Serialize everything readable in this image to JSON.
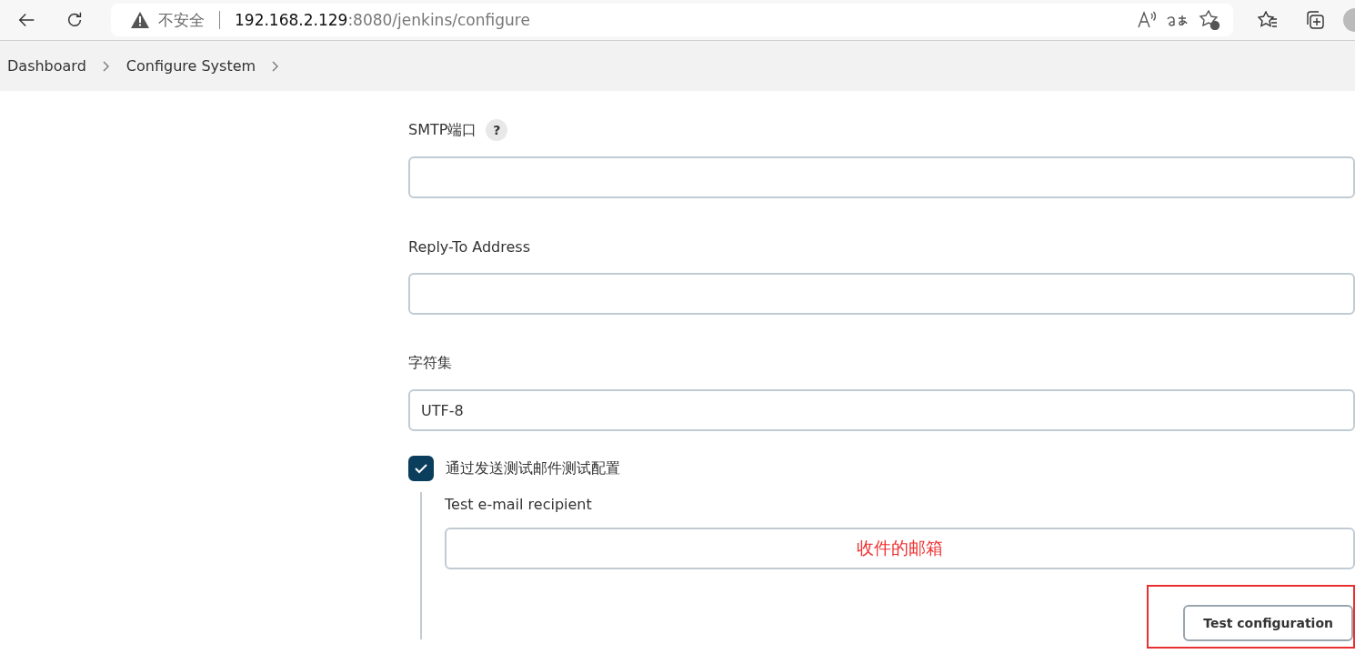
{
  "browser": {
    "security": "不安全",
    "url_host": "192.168.2.129",
    "url_path": ":8080/jenkins/configure"
  },
  "breadcrumb": [
    "Dashboard",
    "Configure System"
  ],
  "fields": [
    {
      "label": "SMTP端口",
      "help": "?"
    },
    {
      "label": "Reply-To Address"
    },
    {
      "label": "字符集",
      "value": "UTF-8"
    }
  ],
  "test_option": {
    "label": "通过发送测试邮件测试配置",
    "checked": true,
    "recipient_label": "Test e-mail recipient",
    "annotation": "收件的邮箱",
    "button": "Test configuration",
    "button_highlighted": true
  }
}
